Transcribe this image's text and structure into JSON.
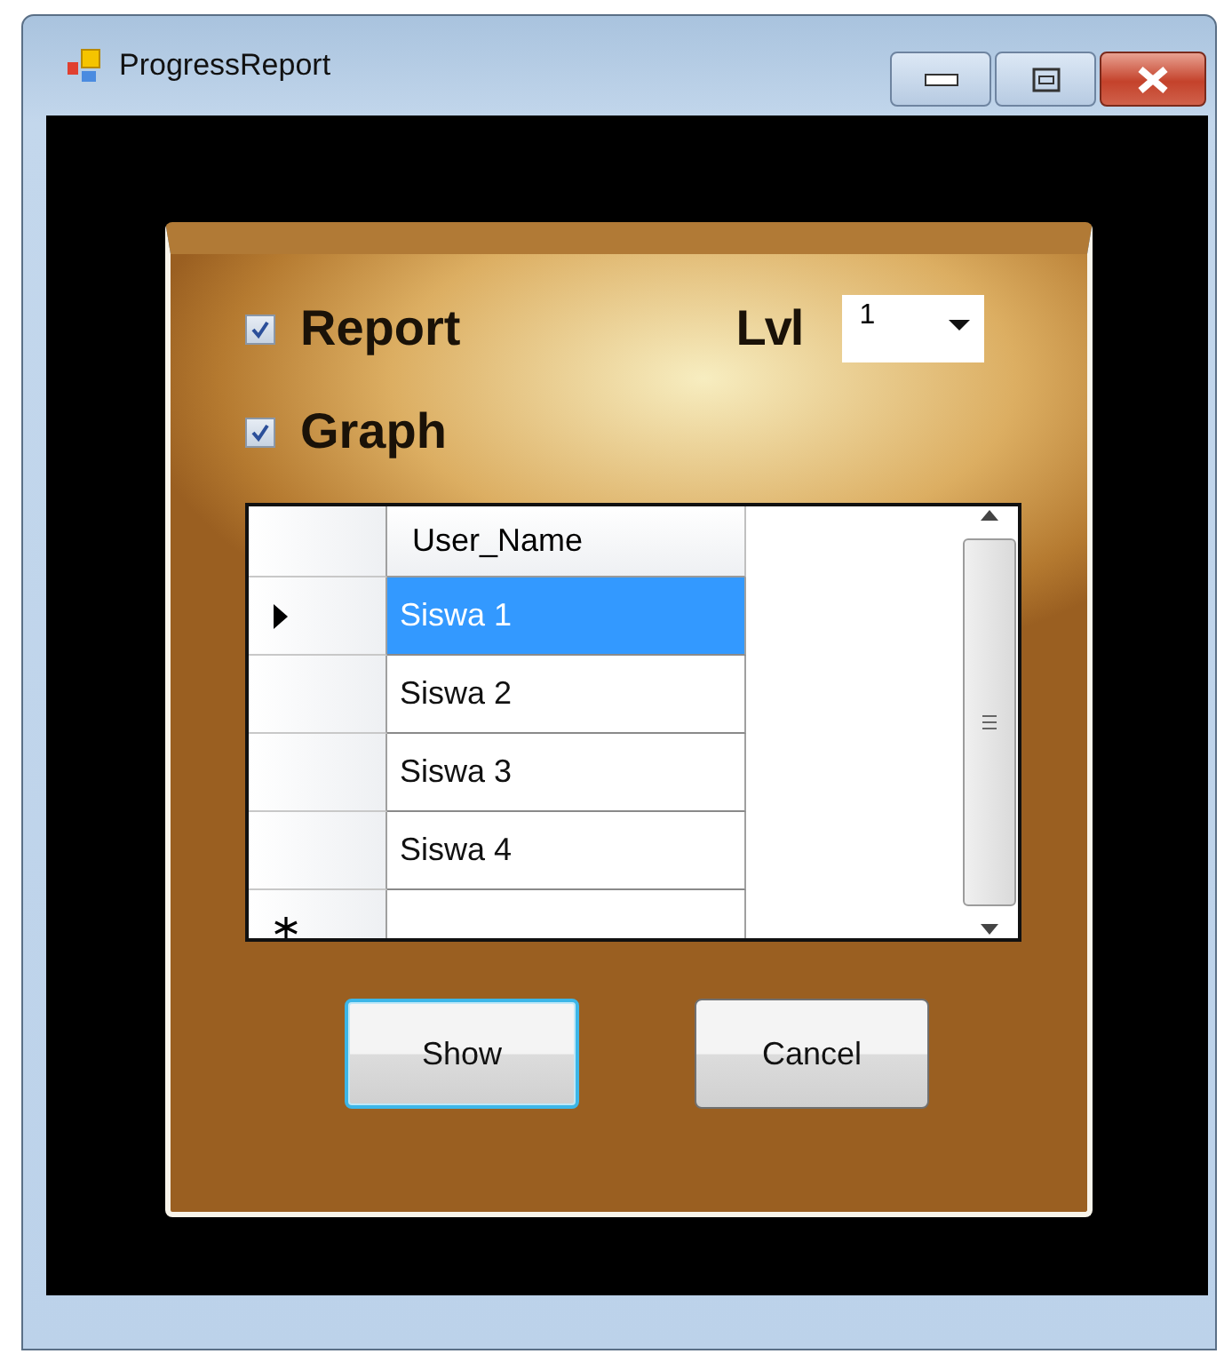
{
  "window": {
    "title": "ProgressReport"
  },
  "options": [
    {
      "label": "Report",
      "checked": true
    },
    {
      "label": "Graph",
      "checked": true
    }
  ],
  "level": {
    "label": "Lvl",
    "value": "1"
  },
  "grid": {
    "columns": [
      "User_Name"
    ],
    "rows": [
      {
        "user_name": "Siswa 1",
        "selected": true,
        "current": true
      },
      {
        "user_name": "Siswa 2",
        "selected": false,
        "current": false
      },
      {
        "user_name": "Siswa 3",
        "selected": false,
        "current": false
      },
      {
        "user_name": "Siswa 4",
        "selected": false,
        "current": false
      }
    ]
  },
  "buttons": [
    {
      "label": "Show",
      "focused": true
    },
    {
      "label": "Cancel",
      "focused": false
    }
  ]
}
